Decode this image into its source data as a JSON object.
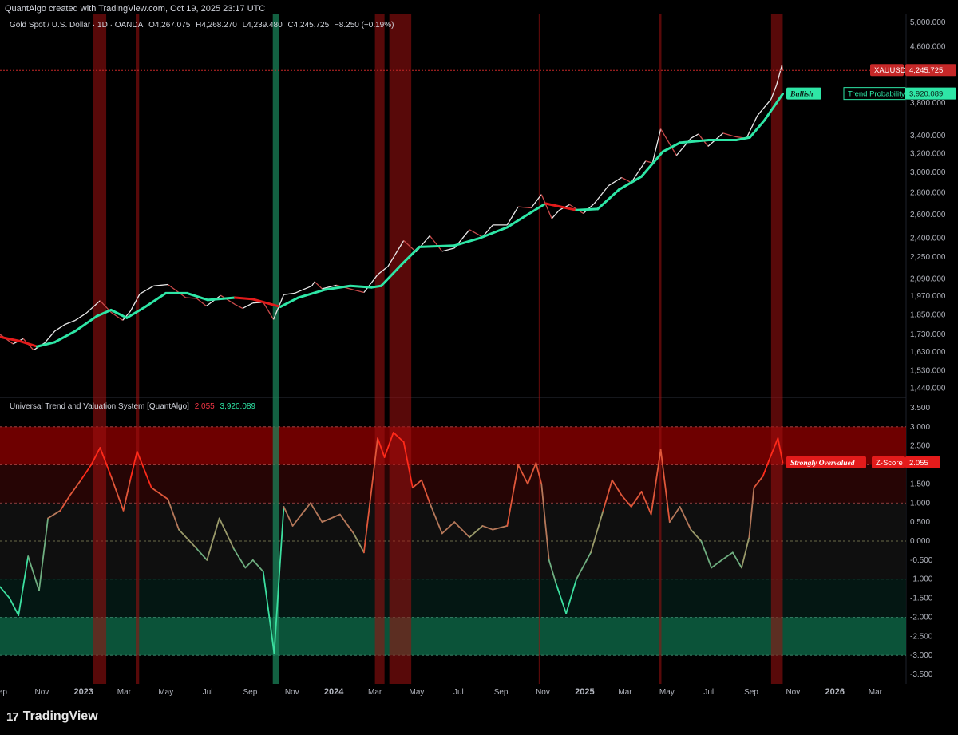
{
  "header": {
    "created": "QuantAlgo created with TradingView.com, Oct 19, 2025 23:17 UTC"
  },
  "main_legend": {
    "symbol": "Gold Spot / U.S. Dollar · 1D · OANDA",
    "open": "O4,267.075",
    "high": "H4,268.270",
    "low": "L4,239.480",
    "close": "C4,245.725",
    "change": "−8.250 (−0.19%)"
  },
  "indicator_legend": {
    "name": "Universal Trend and Valuation System [QuantAlgo]",
    "zscore": "2.055",
    "trend": "3,920.089"
  },
  "tags": {
    "price_symbol": "XAUUSD",
    "price_value": "4,245.725",
    "trend_label": "Trend Probability",
    "trend_value": "3,920.089",
    "bullish": "Bullish",
    "overvalued": "Strongly Overvalued",
    "zscore_label": "Z-Score",
    "zscore_value": "2.055"
  },
  "footer": {
    "brand": "TradingView",
    "logo": "tradingview-logo-icon"
  },
  "colors": {
    "bull": "#2ee6a6",
    "bear": "#e31b1b",
    "overvalued_zone": "#8b0000",
    "undervalued_zone": "#0c5c3f",
    "signal_red": "#c0161688",
    "signal_green": "#1b8a5e"
  },
  "chart_data": [
    {
      "type": "line",
      "title": "Gold Spot / U.S. Dollar · 1D · OANDA",
      "scale": "log",
      "ylim": [
        1400,
        5000
      ],
      "y_ticks": [
        "5,000.000",
        "4,600.000",
        "3,800.000",
        "3,400.000",
        "3,200.000",
        "3,000.000",
        "2,800.000",
        "2,600.000",
        "2,400.000",
        "2,250.000",
        "2,090.000",
        "1,970.000",
        "1,850.000",
        "1,730.000",
        "1,630.000",
        "1,530.000",
        "1,440.000"
      ],
      "x_ticks": [
        "Sep",
        "Nov",
        "2023",
        "Mar",
        "May",
        "Jul",
        "Sep",
        "Nov",
        "2024",
        "Mar",
        "May",
        "Jul",
        "Sep",
        "Nov",
        "2025",
        "Mar",
        "May",
        "Jul",
        "Sep",
        "Nov",
        "2026",
        "Mar"
      ],
      "x_range": [
        "2022-09-01",
        "2026-04-15"
      ],
      "series": [
        {
          "name": "XAUUSD",
          "points": [
            [
              "2022-09-01",
              1730
            ],
            [
              "2022-09-20",
              1675
            ],
            [
              "2022-10-05",
              1705
            ],
            [
              "2022-10-20",
              1640
            ],
            [
              "2022-11-05",
              1680
            ],
            [
              "2022-11-20",
              1750
            ],
            [
              "2022-12-05",
              1790
            ],
            [
              "2022-12-20",
              1815
            ],
            [
              "2023-01-05",
              1860
            ],
            [
              "2023-01-25",
              1940
            ],
            [
              "2023-02-10",
              1865
            ],
            [
              "2023-02-27",
              1815
            ],
            [
              "2023-03-10",
              1870
            ],
            [
              "2023-03-24",
              1985
            ],
            [
              "2023-04-13",
              2040
            ],
            [
              "2023-05-04",
              2050
            ],
            [
              "2023-05-30",
              1960
            ],
            [
              "2023-06-15",
              1955
            ],
            [
              "2023-06-29",
              1905
            ],
            [
              "2023-07-20",
              1975
            ],
            [
              "2023-08-10",
              1915
            ],
            [
              "2023-08-21",
              1890
            ],
            [
              "2023-09-05",
              1925
            ],
            [
              "2023-09-20",
              1930
            ],
            [
              "2023-10-05",
              1820
            ],
            [
              "2023-10-20",
              1980
            ],
            [
              "2023-11-05",
              1990
            ],
            [
              "2023-11-30",
              2040
            ],
            [
              "2023-12-04",
              2070
            ],
            [
              "2023-12-15",
              2020
            ],
            [
              "2024-01-05",
              2045
            ],
            [
              "2024-01-20",
              2025
            ],
            [
              "2024-02-14",
              1995
            ],
            [
              "2024-03-05",
              2120
            ],
            [
              "2024-03-20",
              2180
            ],
            [
              "2024-04-12",
              2380
            ],
            [
              "2024-04-30",
              2290
            ],
            [
              "2024-05-20",
              2420
            ],
            [
              "2024-06-07",
              2295
            ],
            [
              "2024-06-25",
              2320
            ],
            [
              "2024-07-17",
              2470
            ],
            [
              "2024-08-05",
              2410
            ],
            [
              "2024-08-20",
              2510
            ],
            [
              "2024-09-10",
              2510
            ],
            [
              "2024-09-26",
              2670
            ],
            [
              "2024-10-15",
              2660
            ],
            [
              "2024-10-30",
              2785
            ],
            [
              "2024-11-14",
              2565
            ],
            [
              "2024-11-25",
              2640
            ],
            [
              "2024-12-10",
              2690
            ],
            [
              "2024-12-30",
              2610
            ],
            [
              "2025-01-15",
              2700
            ],
            [
              "2025-02-05",
              2870
            ],
            [
              "2025-02-24",
              2950
            ],
            [
              "2025-03-10",
              2900
            ],
            [
              "2025-03-31",
              3120
            ],
            [
              "2025-04-10",
              3100
            ],
            [
              "2025-04-22",
              3480
            ],
            [
              "2025-05-15",
              3180
            ],
            [
              "2025-06-05",
              3370
            ],
            [
              "2025-06-16",
              3420
            ],
            [
              "2025-06-30",
              3280
            ],
            [
              "2025-07-22",
              3430
            ],
            [
              "2025-08-08",
              3390
            ],
            [
              "2025-08-25",
              3370
            ],
            [
              "2025-09-10",
              3640
            ],
            [
              "2025-09-30",
              3850
            ],
            [
              "2025-10-08",
              4040
            ],
            [
              "2025-10-16",
              4330
            ],
            [
              "2025-10-17",
              4245.725
            ]
          ]
        },
        {
          "name": "Trend Probability",
          "points": [
            [
              "2022-09-01",
              1715,
              "bear"
            ],
            [
              "2022-10-01",
              1690,
              "bear"
            ],
            [
              "2022-10-25",
              1660,
              "bear"
            ],
            [
              "2022-11-20",
              1685,
              "bull"
            ],
            [
              "2022-12-20",
              1750,
              "bull"
            ],
            [
              "2023-01-20",
              1840,
              "bull"
            ],
            [
              "2023-02-10",
              1880,
              "bull"
            ],
            [
              "2023-03-05",
              1830,
              "bull"
            ],
            [
              "2023-04-01",
              1900,
              "bull"
            ],
            [
              "2023-05-01",
              1990,
              "bull"
            ],
            [
              "2023-06-01",
              1990,
              "bull"
            ],
            [
              "2023-07-01",
              1945,
              "bull"
            ],
            [
              "2023-08-10",
              1960,
              "bull"
            ],
            [
              "2023-09-05",
              1950,
              "bear"
            ],
            [
              "2023-10-15",
              1900,
              "bear"
            ],
            [
              "2023-11-10",
              1960,
              "bull"
            ],
            [
              "2023-12-20",
              2015,
              "bull"
            ],
            [
              "2024-01-25",
              2040,
              "bull"
            ],
            [
              "2024-02-25",
              2030,
              "bull"
            ],
            [
              "2024-03-10",
              2040,
              "bull"
            ],
            [
              "2024-04-10",
              2200,
              "bull"
            ],
            [
              "2024-05-05",
              2330,
              "bull"
            ],
            [
              "2024-06-25",
              2340,
              "bull"
            ],
            [
              "2024-08-01",
              2400,
              "bull"
            ],
            [
              "2024-09-10",
              2490,
              "bull"
            ],
            [
              "2024-10-15",
              2620,
              "bull"
            ],
            [
              "2024-11-05",
              2700,
              "bull"
            ],
            [
              "2024-11-20",
              2680,
              "bear"
            ],
            [
              "2024-12-20",
              2640,
              "bear"
            ],
            [
              "2025-01-20",
              2650,
              "bull"
            ],
            [
              "2025-02-20",
              2830,
              "bull"
            ],
            [
              "2025-03-25",
              2960,
              "bull"
            ],
            [
              "2025-04-25",
              3220,
              "bull"
            ],
            [
              "2025-05-20",
              3320,
              "bull"
            ],
            [
              "2025-07-01",
              3350,
              "bull"
            ],
            [
              "2025-08-10",
              3350,
              "bull"
            ],
            [
              "2025-08-30",
              3380,
              "bull"
            ],
            [
              "2025-09-20",
              3580,
              "bull"
            ],
            [
              "2025-10-17",
              3920.089,
              "bull"
            ]
          ]
        }
      ]
    },
    {
      "type": "line",
      "title": "Universal Trend and Valuation System [QuantAlgo]",
      "ylim": [
        -3.75,
        3.75
      ],
      "y_ticks": [
        "3.500",
        "3.000",
        "2.500",
        "2.000",
        "1.500",
        "1.000",
        "0.500",
        "0.000",
        "-0.500",
        "-1.000",
        "-1.500",
        "-2.000",
        "-2.500",
        "-3.000",
        "-3.500"
      ],
      "bands": [
        {
          "from": 2.0,
          "to": 3.0,
          "label": "overvalued"
        },
        {
          "from": 1.0,
          "to": 2.0,
          "label": "elevated"
        },
        {
          "from": -1.0,
          "to": 1.0,
          "label": "neutral"
        },
        {
          "from": -2.0,
          "to": -1.0,
          "label": "depressed"
        },
        {
          "from": -3.0,
          "to": -2.0,
          "label": "undervalued"
        }
      ],
      "series": [
        {
          "name": "Z-Score",
          "points": [
            [
              "2022-09-01",
              -1.2
            ],
            [
              "2022-09-15",
              -1.5
            ],
            [
              "2022-09-28",
              -1.95
            ],
            [
              "2022-10-12",
              -0.4
            ],
            [
              "2022-10-28",
              -1.3
            ],
            [
              "2022-11-10",
              0.6
            ],
            [
              "2022-11-28",
              0.8
            ],
            [
              "2022-12-12",
              1.2
            ],
            [
              "2022-12-28",
              1.6
            ],
            [
              "2023-01-12",
              2.0
            ],
            [
              "2023-01-25",
              2.45
            ],
            [
              "2023-02-10",
              1.7
            ],
            [
              "2023-02-28",
              0.8
            ],
            [
              "2023-03-10",
              1.6
            ],
            [
              "2023-03-20",
              2.35
            ],
            [
              "2023-04-10",
              1.4
            ],
            [
              "2023-05-04",
              1.1
            ],
            [
              "2023-05-20",
              0.3
            ],
            [
              "2023-06-15",
              -0.2
            ],
            [
              "2023-06-30",
              -0.5
            ],
            [
              "2023-07-18",
              0.6
            ],
            [
              "2023-08-08",
              -0.2
            ],
            [
              "2023-08-25",
              -0.7
            ],
            [
              "2023-09-05",
              -0.5
            ],
            [
              "2023-09-20",
              -0.8
            ],
            [
              "2023-10-06",
              -2.95
            ],
            [
              "2023-10-20",
              0.9
            ],
            [
              "2023-11-02",
              0.4
            ],
            [
              "2023-11-28",
              1.0
            ],
            [
              "2023-12-15",
              0.5
            ],
            [
              "2024-01-10",
              0.7
            ],
            [
              "2024-01-30",
              0.2
            ],
            [
              "2024-02-14",
              -0.3
            ],
            [
              "2024-03-05",
              2.7
            ],
            [
              "2024-03-15",
              2.2
            ],
            [
              "2024-03-28",
              2.85
            ],
            [
              "2024-04-12",
              2.6
            ],
            [
              "2024-04-25",
              1.4
            ],
            [
              "2024-05-08",
              1.6
            ],
            [
              "2024-05-20",
              1.0
            ],
            [
              "2024-06-07",
              0.2
            ],
            [
              "2024-06-25",
              0.5
            ],
            [
              "2024-07-17",
              0.1
            ],
            [
              "2024-08-05",
              0.4
            ],
            [
              "2024-08-20",
              0.3
            ],
            [
              "2024-09-10",
              0.4
            ],
            [
              "2024-09-26",
              2.0
            ],
            [
              "2024-10-10",
              1.5
            ],
            [
              "2024-10-22",
              2.05
            ],
            [
              "2024-10-30",
              1.5
            ],
            [
              "2024-11-10",
              -0.5
            ],
            [
              "2024-11-20",
              -1.1
            ],
            [
              "2024-12-05",
              -1.9
            ],
            [
              "2024-12-20",
              -1.0
            ],
            [
              "2025-01-10",
              -0.3
            ],
            [
              "2025-01-28",
              0.8
            ],
            [
              "2025-02-10",
              1.6
            ],
            [
              "2025-02-24",
              1.2
            ],
            [
              "2025-03-10",
              0.9
            ],
            [
              "2025-03-25",
              1.3
            ],
            [
              "2025-04-08",
              0.7
            ],
            [
              "2025-04-22",
              2.4
            ],
            [
              "2025-05-05",
              0.5
            ],
            [
              "2025-05-20",
              0.9
            ],
            [
              "2025-06-05",
              0.3
            ],
            [
              "2025-06-20",
              0.0
            ],
            [
              "2025-07-05",
              -0.7
            ],
            [
              "2025-07-20",
              -0.5
            ],
            [
              "2025-08-05",
              -0.3
            ],
            [
              "2025-08-18",
              -0.7
            ],
            [
              "2025-08-29",
              0.1
            ],
            [
              "2025-09-05",
              1.4
            ],
            [
              "2025-09-18",
              1.7
            ],
            [
              "2025-10-01",
              2.3
            ],
            [
              "2025-10-10",
              2.7
            ],
            [
              "2025-10-17",
              2.055
            ]
          ]
        }
      ]
    }
  ],
  "signal_bands": [
    {
      "from": "2023-01-15",
      "to": "2023-02-03",
      "color": "red"
    },
    {
      "from": "2023-03-18",
      "to": "2023-03-23",
      "color": "red"
    },
    {
      "from": "2023-10-04",
      "to": "2023-10-13",
      "color": "green"
    },
    {
      "from": "2024-03-01",
      "to": "2024-03-15",
      "color": "red"
    },
    {
      "from": "2024-03-22",
      "to": "2024-04-23",
      "color": "red"
    },
    {
      "from": "2024-10-26",
      "to": "2024-10-28",
      "color": "red"
    },
    {
      "from": "2025-04-20",
      "to": "2025-04-23",
      "color": "red"
    },
    {
      "from": "2025-09-30",
      "to": "2025-10-17",
      "color": "red"
    }
  ]
}
